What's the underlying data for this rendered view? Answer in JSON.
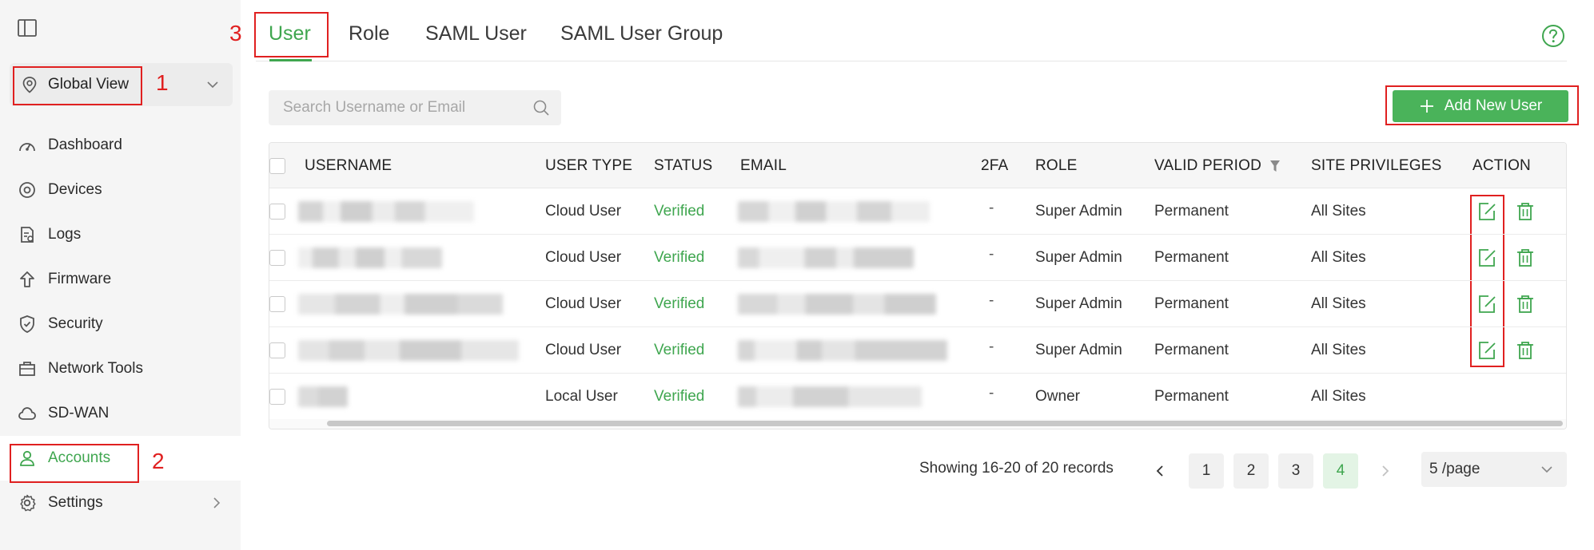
{
  "sidebar": {
    "site_selector": {
      "label": "Global View"
    },
    "items": [
      {
        "label": "Dashboard",
        "icon": "dashboard-icon"
      },
      {
        "label": "Devices",
        "icon": "devices-icon"
      },
      {
        "label": "Logs",
        "icon": "logs-icon"
      },
      {
        "label": "Firmware",
        "icon": "firmware-icon"
      },
      {
        "label": "Security",
        "icon": "shield-icon"
      },
      {
        "label": "Network Tools",
        "icon": "toolbox-icon"
      },
      {
        "label": "SD-WAN",
        "icon": "cloud-icon"
      },
      {
        "label": "Accounts",
        "icon": "user-icon",
        "active": true
      },
      {
        "label": "Settings",
        "icon": "gear-icon",
        "has_submenu": true
      }
    ]
  },
  "annotations": {
    "n1": "1",
    "n2": "2",
    "n3": "3"
  },
  "tabs": [
    {
      "label": "User",
      "active": true
    },
    {
      "label": "Role"
    },
    {
      "label": "SAML User"
    },
    {
      "label": "SAML User Group"
    }
  ],
  "search": {
    "placeholder": "Search Username or Email",
    "value": ""
  },
  "add_button": {
    "label": "Add New User"
  },
  "table": {
    "columns": [
      "USERNAME",
      "USER TYPE",
      "STATUS",
      "EMAIL",
      "2FA",
      "ROLE",
      "VALID PERIOD",
      "SITE PRIVILEGES",
      "ACTION"
    ],
    "rows": [
      {
        "user_type": "Cloud User",
        "status": "Verified",
        "twofa": "-",
        "role": "Super Admin",
        "valid_period": "Permanent",
        "site_privileges": "All Sites"
      },
      {
        "user_type": "Cloud User",
        "status": "Verified",
        "twofa": "-",
        "role": "Super Admin",
        "valid_period": "Permanent",
        "site_privileges": "All Sites"
      },
      {
        "user_type": "Cloud User",
        "status": "Verified",
        "twofa": "-",
        "role": "Super Admin",
        "valid_period": "Permanent",
        "site_privileges": "All Sites"
      },
      {
        "user_type": "Cloud User",
        "status": "Verified",
        "twofa": "-",
        "role": "Super Admin",
        "valid_period": "Permanent",
        "site_privileges": "All Sites"
      },
      {
        "user_type": "Local User",
        "status": "Verified",
        "twofa": "-",
        "role": "Owner",
        "valid_period": "Permanent",
        "site_privileges": "All Sites"
      }
    ]
  },
  "pagination": {
    "info": "Showing 16-20 of 20 records",
    "pages": [
      "1",
      "2",
      "3",
      "4"
    ],
    "current": "4",
    "per_page": "5 /page"
  },
  "colors": {
    "accent": "#3fa64f",
    "button": "#4ab35a",
    "annotation": "#e02020"
  }
}
